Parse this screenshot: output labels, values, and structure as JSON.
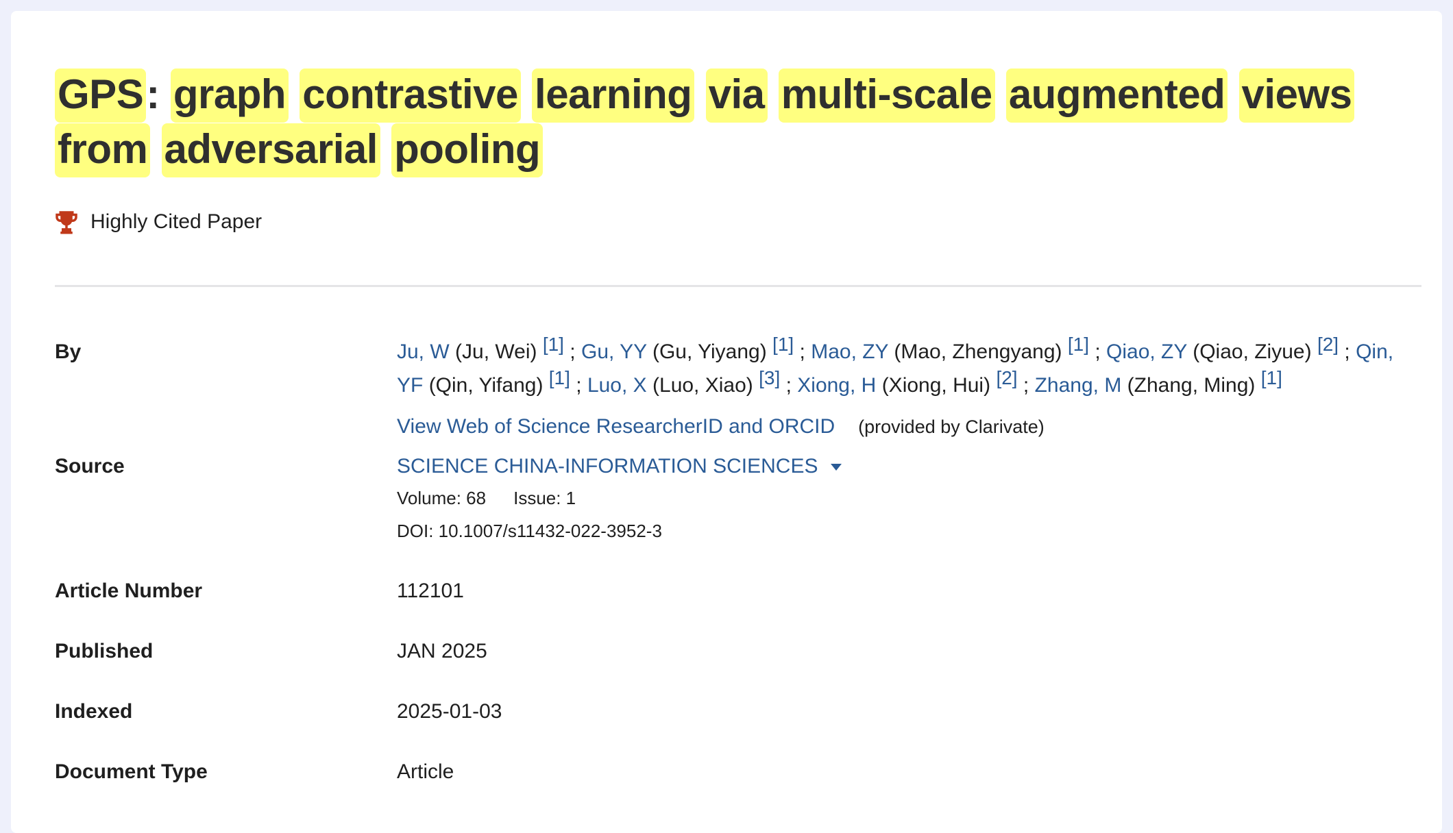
{
  "title_words": [
    "GPS",
    "graph",
    "contrastive",
    "learning",
    "via",
    "multi-scale",
    "augmented",
    "views",
    "from",
    "adversarial",
    "pooling"
  ],
  "badge": {
    "icon": "trophy-icon",
    "text": "Highly Cited Paper",
    "color": "#c0391a"
  },
  "labels": {
    "by": "By",
    "source": "Source",
    "article_number": "Article Number",
    "published": "Published",
    "indexed": "Indexed",
    "document_type": "Document Type"
  },
  "authors": [
    {
      "short": "Ju, W",
      "full": "(Ju, Wei)",
      "aff": "[1]"
    },
    {
      "short": "Gu, YY",
      "full": "(Gu, Yiyang)",
      "aff": "[1]"
    },
    {
      "short": "Mao, ZY",
      "full": "(Mao, Zhengyang)",
      "aff": "[1]"
    },
    {
      "short": "Qiao, ZY",
      "full": "(Qiao, Ziyue)",
      "aff": "[2]"
    },
    {
      "short": "Qin, YF",
      "full": "(Qin, Yifang)",
      "aff": "[1]"
    },
    {
      "short": "Luo, X",
      "full": "(Luo, Xiao)",
      "aff": "[3]"
    },
    {
      "short": "Xiong, H",
      "full": "(Xiong, Hui)",
      "aff": "[2]"
    },
    {
      "short": "Zhang, M",
      "full": "(Zhang, Ming)",
      "aff": "[1]"
    }
  ],
  "researcher_link": "View Web of Science ResearcherID and ORCID",
  "provided_by": "(provided by Clarivate)",
  "source": {
    "journal": "SCIENCE CHINA-INFORMATION SCIENCES",
    "volume": "Volume: 68",
    "issue": "Issue: 1",
    "doi": "DOI: 10.1007/s11432-022-3952-3"
  },
  "article_number": "112101",
  "published": "JAN 2025",
  "indexed": "2025-01-03",
  "document_type": "Article",
  "colors": {
    "link": "#2a5b96",
    "highlight": "#ffff80",
    "page_bg": "#eef0fb"
  }
}
